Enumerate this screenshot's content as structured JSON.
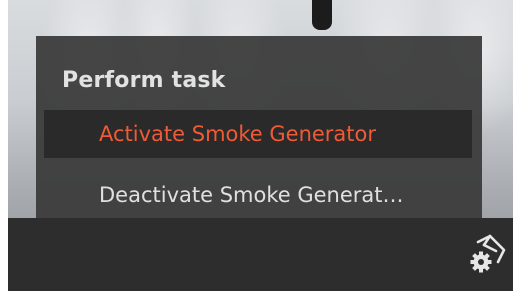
{
  "task_menu": {
    "title": "Perform task",
    "items": [
      {
        "label": "Activate Smoke Generator",
        "state": "highlighted"
      },
      {
        "label": "Deactivate Smoke Generat…",
        "state": "normal"
      }
    ]
  },
  "toolbar": {
    "icons": [
      "task-settings-icon"
    ]
  },
  "colors": {
    "highlight_text": "#f05a35",
    "menu_background": "#3a3a3a",
    "toolbar_background": "#2d2d2d"
  }
}
